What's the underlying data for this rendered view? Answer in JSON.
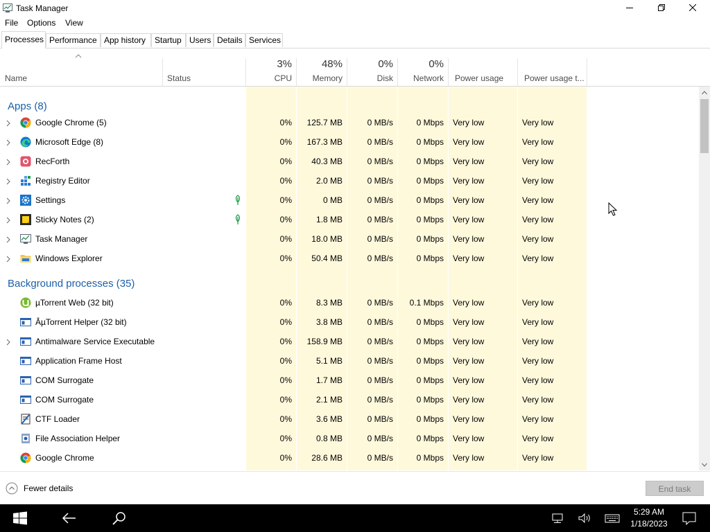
{
  "window": {
    "title": "Task Manager"
  },
  "menu": [
    "File",
    "Options",
    "View"
  ],
  "tabs": [
    "Processes",
    "Performance",
    "App history",
    "Startup",
    "Users",
    "Details",
    "Services"
  ],
  "header": {
    "name": "Name",
    "status": "Status",
    "cpu": {
      "pct": "3%",
      "label": "CPU"
    },
    "memory": {
      "pct": "48%",
      "label": "Memory"
    },
    "disk": {
      "pct": "0%",
      "label": "Disk"
    },
    "network": {
      "pct": "0%",
      "label": "Network"
    },
    "power": "Power usage",
    "power_trend": "Power usage t..."
  },
  "groups": {
    "apps": "Apps (8)",
    "background": "Background processes (35)"
  },
  "apps": [
    {
      "name": "Google Chrome (5)",
      "icon": "chrome-icon",
      "expand": true,
      "leaf": false,
      "cpu": "0%",
      "mem": "125.7 MB",
      "disk": "0 MB/s",
      "net": "0 Mbps",
      "power": "Very low",
      "trend": "Very low"
    },
    {
      "name": "Microsoft Edge (8)",
      "icon": "edge-icon",
      "expand": true,
      "leaf": false,
      "cpu": "0%",
      "mem": "167.3 MB",
      "disk": "0 MB/s",
      "net": "0 Mbps",
      "power": "Very low",
      "trend": "Very low"
    },
    {
      "name": "RecForth",
      "icon": "recforth-icon",
      "expand": true,
      "leaf": false,
      "cpu": "0%",
      "mem": "40.3 MB",
      "disk": "0 MB/s",
      "net": "0 Mbps",
      "power": "Very low",
      "trend": "Very low"
    },
    {
      "name": "Registry Editor",
      "icon": "registry-editor-icon",
      "expand": true,
      "leaf": false,
      "cpu": "0%",
      "mem": "2.0 MB",
      "disk": "0 MB/s",
      "net": "0 Mbps",
      "power": "Very low",
      "trend": "Very low"
    },
    {
      "name": "Settings",
      "icon": "settings-gear-icon",
      "expand": true,
      "leaf": true,
      "cpu": "0%",
      "mem": "0 MB",
      "disk": "0 MB/s",
      "net": "0 Mbps",
      "power": "Very low",
      "trend": "Very low"
    },
    {
      "name": "Sticky Notes (2)",
      "icon": "sticky-notes-icon",
      "expand": true,
      "leaf": true,
      "cpu": "0%",
      "mem": "1.8 MB",
      "disk": "0 MB/s",
      "net": "0 Mbps",
      "power": "Very low",
      "trend": "Very low"
    },
    {
      "name": "Task Manager",
      "icon": "task-manager-icon",
      "expand": true,
      "leaf": false,
      "cpu": "0%",
      "mem": "18.0 MB",
      "disk": "0 MB/s",
      "net": "0 Mbps",
      "power": "Very low",
      "trend": "Very low"
    },
    {
      "name": "Windows Explorer",
      "icon": "folder-icon",
      "expand": true,
      "leaf": false,
      "cpu": "0%",
      "mem": "50.4 MB",
      "disk": "0 MB/s",
      "net": "0 Mbps",
      "power": "Very low",
      "trend": "Very low"
    }
  ],
  "background": [
    {
      "name": "µTorrent Web (32 bit)",
      "icon": "utorrent-icon",
      "expand": false,
      "cpu": "0%",
      "mem": "8.3 MB",
      "disk": "0 MB/s",
      "net": "0.1 Mbps",
      "power": "Very low",
      "trend": "Very low"
    },
    {
      "name": "ÂµTorrent Helper (32 bit)",
      "icon": "service-window-icon",
      "expand": false,
      "cpu": "0%",
      "mem": "3.8 MB",
      "disk": "0 MB/s",
      "net": "0 Mbps",
      "power": "Very low",
      "trend": "Very low"
    },
    {
      "name": "Antimalware Service Executable",
      "icon": "service-window-icon",
      "expand": true,
      "cpu": "0%",
      "mem": "158.9 MB",
      "disk": "0 MB/s",
      "net": "0 Mbps",
      "power": "Very low",
      "trend": "Very low"
    },
    {
      "name": "Application Frame Host",
      "icon": "service-window-icon",
      "expand": false,
      "cpu": "0%",
      "mem": "5.1 MB",
      "disk": "0 MB/s",
      "net": "0 Mbps",
      "power": "Very low",
      "trend": "Very low"
    },
    {
      "name": "COM Surrogate",
      "icon": "service-window-icon",
      "expand": false,
      "cpu": "0%",
      "mem": "1.7 MB",
      "disk": "0 MB/s",
      "net": "0 Mbps",
      "power": "Very low",
      "trend": "Very low"
    },
    {
      "name": "COM Surrogate",
      "icon": "service-window-icon",
      "expand": false,
      "cpu": "0%",
      "mem": "2.1 MB",
      "disk": "0 MB/s",
      "net": "0 Mbps",
      "power": "Very low",
      "trend": "Very low"
    },
    {
      "name": "CTF Loader",
      "icon": "ctf-loader-icon",
      "expand": false,
      "cpu": "0%",
      "mem": "3.6 MB",
      "disk": "0 MB/s",
      "net": "0 Mbps",
      "power": "Very low",
      "trend": "Very low"
    },
    {
      "name": "File Association Helper",
      "icon": "file-association-icon",
      "expand": false,
      "cpu": "0%",
      "mem": "0.8 MB",
      "disk": "0 MB/s",
      "net": "0 Mbps",
      "power": "Very low",
      "trend": "Very low"
    },
    {
      "name": "Google Chrome",
      "icon": "chrome-icon",
      "expand": false,
      "cpu": "0%",
      "mem": "28.6 MB",
      "disk": "0 MB/s",
      "net": "0 Mbps",
      "power": "Very low",
      "trend": "Very low"
    }
  ],
  "footer": {
    "fewer": "Fewer details",
    "end_task": "End task"
  },
  "taskbar": {
    "time": "5:29 AM",
    "date": "1/18/2023"
  },
  "colors": {
    "heat_light": "#fff9dc",
    "heat_medium": "#fff4c4",
    "group_title": "#1c5fa8"
  }
}
